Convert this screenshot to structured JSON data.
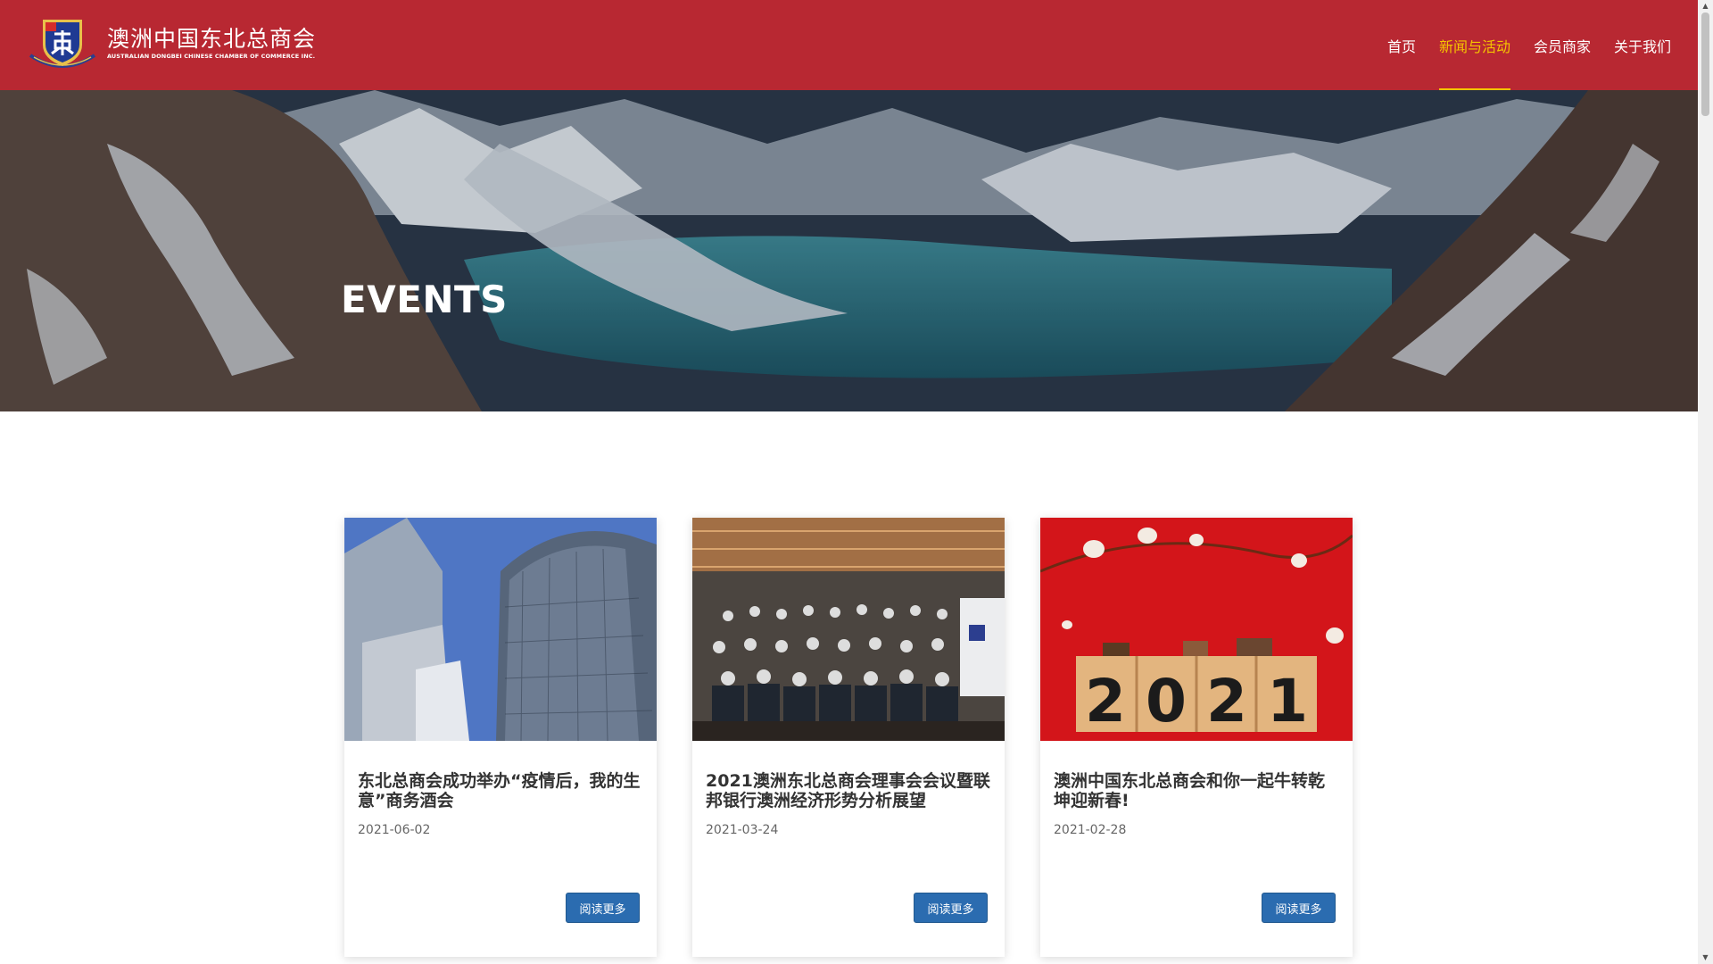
{
  "header": {
    "logo_cn": "澳洲中国东北总商会",
    "logo_en": "AUSTRALIAN DONGBEI CHINESE CHAMBER OF COMMERCE INC.",
    "nav": [
      {
        "label": "首页",
        "active": false
      },
      {
        "label": "新闻与活动",
        "active": true
      },
      {
        "label": "会员商家",
        "active": false
      },
      {
        "label": "关于我们",
        "active": false
      }
    ]
  },
  "hero": {
    "title": "EVENTS"
  },
  "cards": [
    {
      "title": "东北总商会成功举办“疫情后，我的生意”商务酒会",
      "date": "2021-06-02",
      "button": "阅读更多",
      "image": "office-towers"
    },
    {
      "title": "2021澳洲东北总商会理事会会议暨联邦银行澳洲经济形势分析展望",
      "date": "2021-03-24",
      "button": "阅读更多",
      "image": "group-photo"
    },
    {
      "title": "澳洲中国东北总商会和你一起牛转乾坤迎新春!",
      "date": "2021-02-28",
      "button": "阅读更多",
      "image": "new-year-2021",
      "image_text": "2021"
    }
  ],
  "colors": {
    "header": "#b82832",
    "nav_active": "#f5c400",
    "button": "#2b6cb0"
  }
}
